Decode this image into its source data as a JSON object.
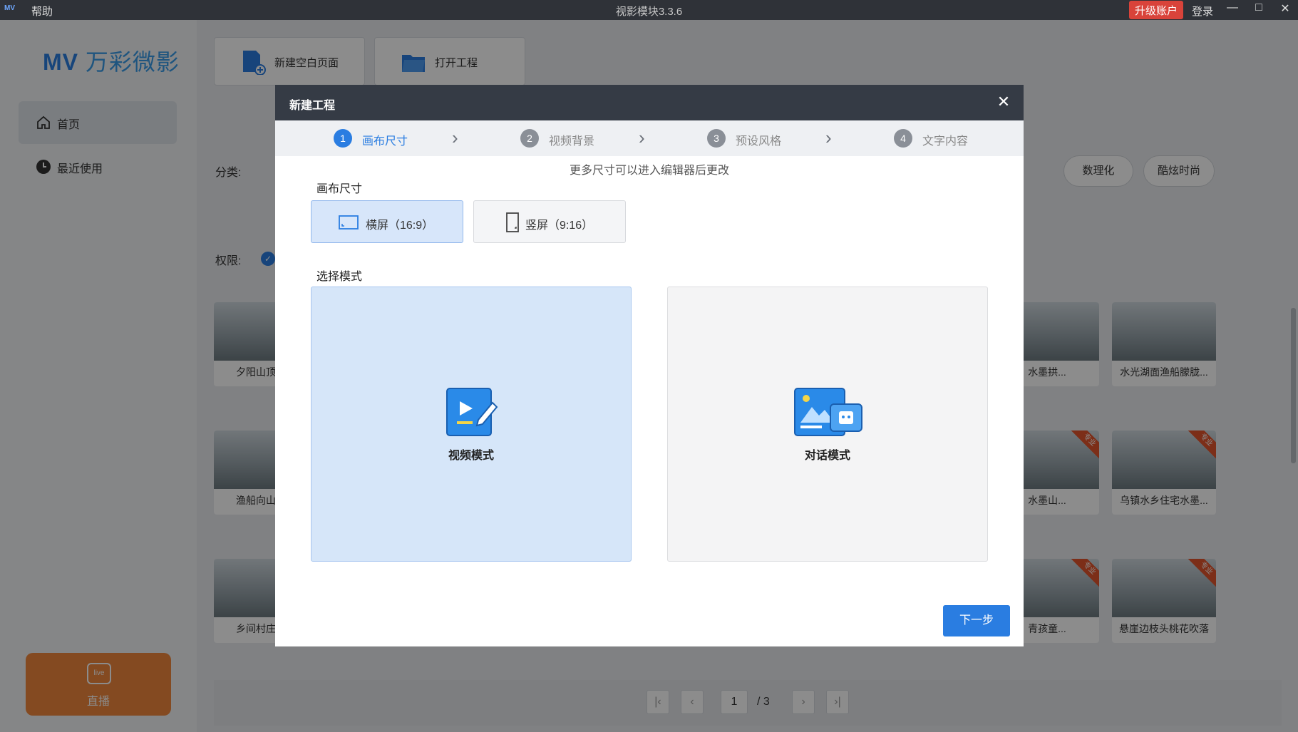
{
  "window": {
    "logo_text": "MV",
    "help_menu": "帮助",
    "title": "视影模块3.3.6",
    "upgrade": "升级账户",
    "login": "登录",
    "minimize_icon": "minimize-icon",
    "maximize_icon": "maximize-icon",
    "close_icon": "close-icon"
  },
  "sidebar": {
    "brand_latin": "MV",
    "brand_cn": "万彩微影",
    "items": [
      {
        "label": "首页",
        "icon": "home-icon"
      },
      {
        "label": "最近使用",
        "icon": "clock-icon"
      }
    ],
    "live_badge": "live",
    "live_label": "直播"
  },
  "toolbar": {
    "new_blank": "新建空白页面",
    "open_project": "打开工程"
  },
  "filters": {
    "category_label": "分类:",
    "permission_label": "权限:",
    "pills": [
      "数理化",
      "酷炫时尚"
    ]
  },
  "templates": [
    {
      "name": "夕阳山顶瀑布"
    },
    {
      "name": "水墨拱..."
    },
    {
      "name": "水光湖面渔船朦胧..."
    },
    {
      "name": "渔船向山谷里"
    },
    {
      "name": "水墨山..."
    },
    {
      "name": "乌镇水乡住宅水墨..."
    },
    {
      "name": "乡间村庄小桥"
    },
    {
      "name": "青孩童..."
    },
    {
      "name": "悬崖边枝头桃花吹落"
    }
  ],
  "pro_tag": "专业",
  "pager": {
    "current": "1",
    "total": "/ 3"
  },
  "dialog": {
    "title": "新建工程",
    "steps": [
      {
        "num": "1",
        "label": "画布尺寸"
      },
      {
        "num": "2",
        "label": "视频背景"
      },
      {
        "num": "3",
        "label": "预设风格"
      },
      {
        "num": "4",
        "label": "文字内容"
      }
    ],
    "hint": "更多尺寸可以进入编辑器后更改",
    "canvas_section": "画布尺寸",
    "canvas_options": [
      {
        "label": "横屏（16:9）",
        "icon": "landscape-screen-icon",
        "selected": true
      },
      {
        "label": "竖屏（9:16）",
        "icon": "portrait-screen-icon",
        "selected": false
      }
    ],
    "mode_section": "选择模式",
    "modes": [
      {
        "label": "视频模式",
        "icon": "video-edit-icon",
        "selected": true
      },
      {
        "label": "对话模式",
        "icon": "chat-robot-icon",
        "selected": false
      }
    ],
    "next": "下一步"
  },
  "colors": {
    "accent": "#2a7de1",
    "titlebar": "#2f3238",
    "dialog_header": "#353b45",
    "upgrade": "#d9433a",
    "live": "#f0873c",
    "selected_bg": "#d6e6f9"
  }
}
